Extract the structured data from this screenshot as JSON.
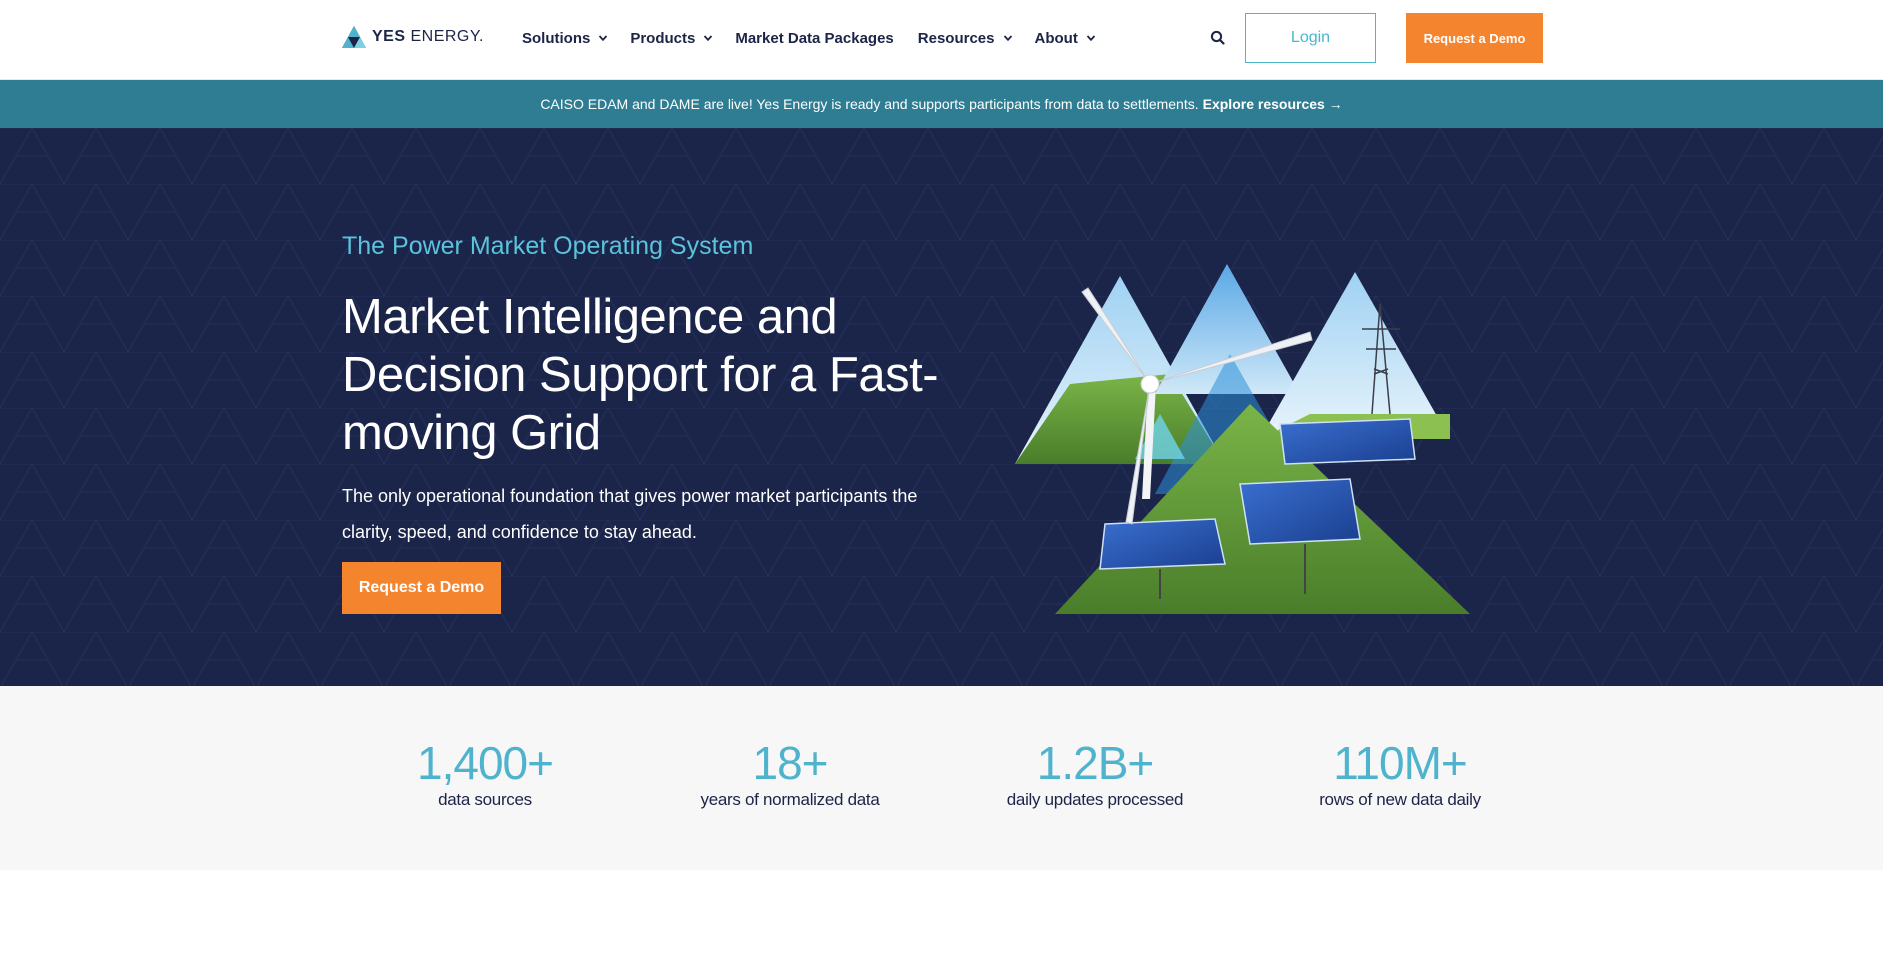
{
  "brand": {
    "name_bold": "YES",
    "name_light": "ENERGY."
  },
  "nav": {
    "items": [
      {
        "label": "Solutions",
        "has_dropdown": true
      },
      {
        "label": "Products",
        "has_dropdown": true
      },
      {
        "label": "Market Data Packages",
        "has_dropdown": false
      },
      {
        "label": "Resources",
        "has_dropdown": true
      },
      {
        "label": "About",
        "has_dropdown": true
      }
    ],
    "login_label": "Login",
    "demo_label": "Request a Demo"
  },
  "announcement": {
    "text": "CAISO EDAM and DAME are live! Yes Energy is ready and supports participants from data to settlements.",
    "link_label": "Explore resources →"
  },
  "hero": {
    "eyebrow": "The Power Market Operating System",
    "title": "Market Intelligence and Decision Support for a Fast-moving Grid",
    "subtitle": "The only operational foundation that gives power market participants the clarity, speed, and confidence to stay ahead.",
    "cta_label": "Request a Demo"
  },
  "stats": [
    {
      "value": "1,400+",
      "label": "data sources"
    },
    {
      "value": "18+",
      "label": "years of normalized data"
    },
    {
      "value": "1.2B+",
      "label": "daily updates processed"
    },
    {
      "value": "110M+",
      "label": "rows of new data daily"
    }
  ],
  "colors": {
    "navy": "#1b2449",
    "accent_teal": "#4fb3ce",
    "announcement_bg": "#2f7d93",
    "cta_orange": "#f5842f"
  },
  "icons": {
    "logo": "triangle-logo-icon",
    "search": "search-icon",
    "dropdown": "chevron-down-icon"
  }
}
